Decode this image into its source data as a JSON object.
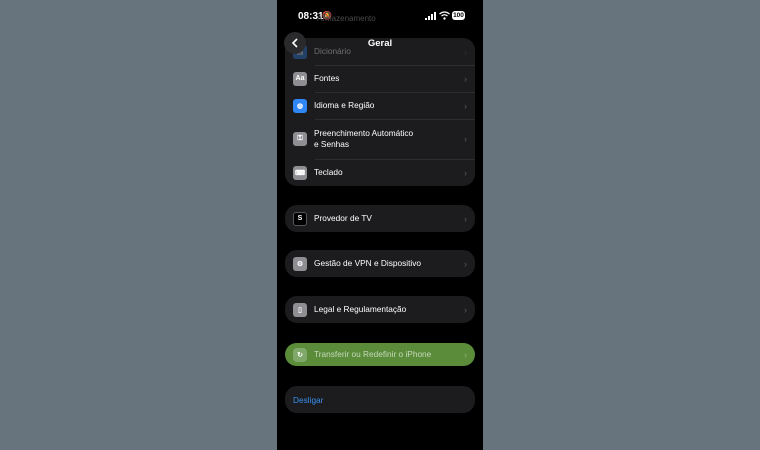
{
  "status": {
    "time": "08:31",
    "battery": "100"
  },
  "nav": {
    "title": "Geral",
    "faded_top": "Armazenamento"
  },
  "group1": [
    {
      "label": "Dicionário",
      "icon": "book-icon"
    },
    {
      "label": "Fontes",
      "icon": "font-icon"
    },
    {
      "label": "Idioma e Região",
      "icon": "globe-icon"
    },
    {
      "label": "Preenchimento Automático",
      "label2": "e Senhas",
      "icon": "key-icon"
    },
    {
      "label": "Teclado",
      "icon": "keyboard-icon"
    }
  ],
  "tv": {
    "label": "Provedor de TV"
  },
  "vpn": {
    "label": "Gestão de VPN e Dispositivo"
  },
  "legal": {
    "label": "Legal e Regulamentação"
  },
  "reset": {
    "label": "Transferir ou Redefinir o iPhone"
  },
  "shutdown": {
    "label": "Desligar"
  },
  "colors": {
    "accent": "#2f86f6",
    "highlight": "#5a8c3a",
    "link": "#3a8ef0"
  }
}
